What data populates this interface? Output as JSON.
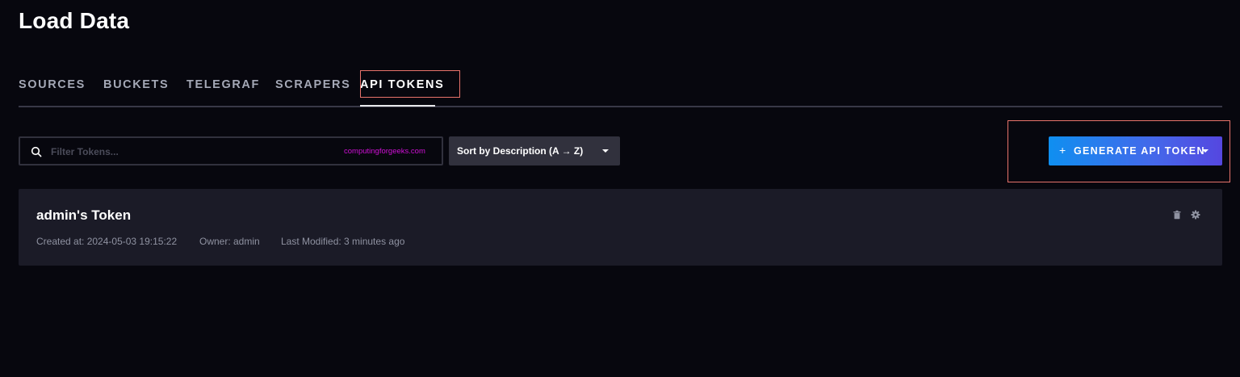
{
  "page": {
    "title": "Load Data"
  },
  "tabs": [
    {
      "label": "SOURCES",
      "active": false
    },
    {
      "label": "BUCKETS",
      "active": false
    },
    {
      "label": "TELEGRAF",
      "active": false
    },
    {
      "label": "SCRAPERS",
      "active": false
    },
    {
      "label": "API TOKENS",
      "active": true
    }
  ],
  "toolbar": {
    "search": {
      "placeholder": "Filter Tokens...",
      "value": "",
      "icon": "search-icon"
    },
    "watermark": "computingforgeeks.com",
    "sort": {
      "selected": "Sort by Description (A → Z)",
      "icon": "chevron-down-icon"
    },
    "generate_button": {
      "icon": "+",
      "label": "GENERATE API TOKEN",
      "caret_icon": "chevron-down-icon"
    }
  },
  "tokens": [
    {
      "name": "admin's Token",
      "created_at": "Created at: 2024-05-03 19:15:22",
      "owner": "Owner: admin",
      "last_modified": "Last Modified: 3 minutes ago",
      "actions": [
        "trash-icon",
        "gear-icon"
      ]
    }
  ],
  "colors": {
    "background": "#07070e",
    "card": "#1b1b27",
    "highlight_box": "#e8736b",
    "button_gradient_start": "#0f8ff0",
    "button_gradient_end": "#5547e0",
    "watermark": "#d010d6"
  }
}
